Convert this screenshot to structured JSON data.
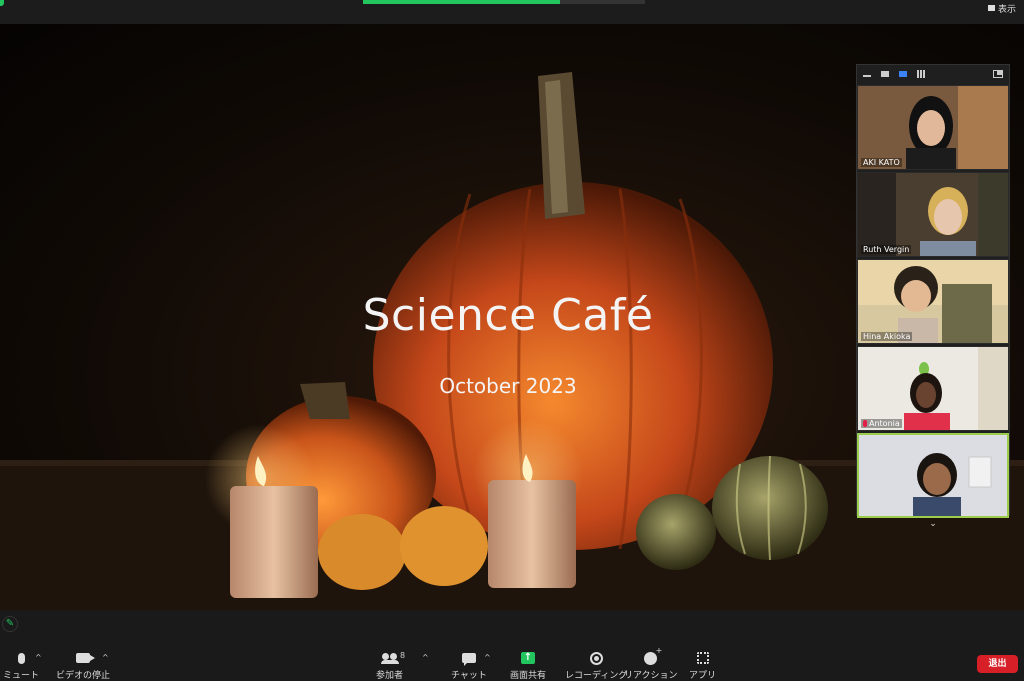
{
  "top_bar": {
    "view_label": "表示",
    "share_progress": 0.7
  },
  "slide": {
    "title": "Science Café",
    "subtitle": "October 2023"
  },
  "gallery": {
    "participants": [
      {
        "name": "AKI KATO",
        "muted": false
      },
      {
        "name": "Ruth Vergin",
        "muted": false
      },
      {
        "name": "Hina Akioka",
        "muted": false
      },
      {
        "name": "Antonia",
        "muted": true
      },
      {
        "name": "",
        "muted": false,
        "active_speaker": true
      }
    ],
    "more_label": "⌄"
  },
  "toolbar": {
    "mute_label": "ミュート",
    "video_label": "ビデオの停止",
    "participants_label": "参加者",
    "participants_count": "8",
    "chat_label": "チャット",
    "share_label": "画面共有",
    "record_label": "レコーディング",
    "reaction_label": "リアクション",
    "apps_label": "アプリ",
    "leave_label": "退出",
    "caret": "^"
  },
  "colors": {
    "share_green": "#22c55e",
    "leave_red": "#d61f26",
    "active_border": "#9bcc4b",
    "pumpkin": "#d9561a"
  },
  "icons": [
    "pencil-icon",
    "microphone-icon",
    "video-camera-icon",
    "participants-icon",
    "chat-icon",
    "share-screen-icon",
    "record-icon",
    "reaction-icon",
    "apps-icon"
  ]
}
